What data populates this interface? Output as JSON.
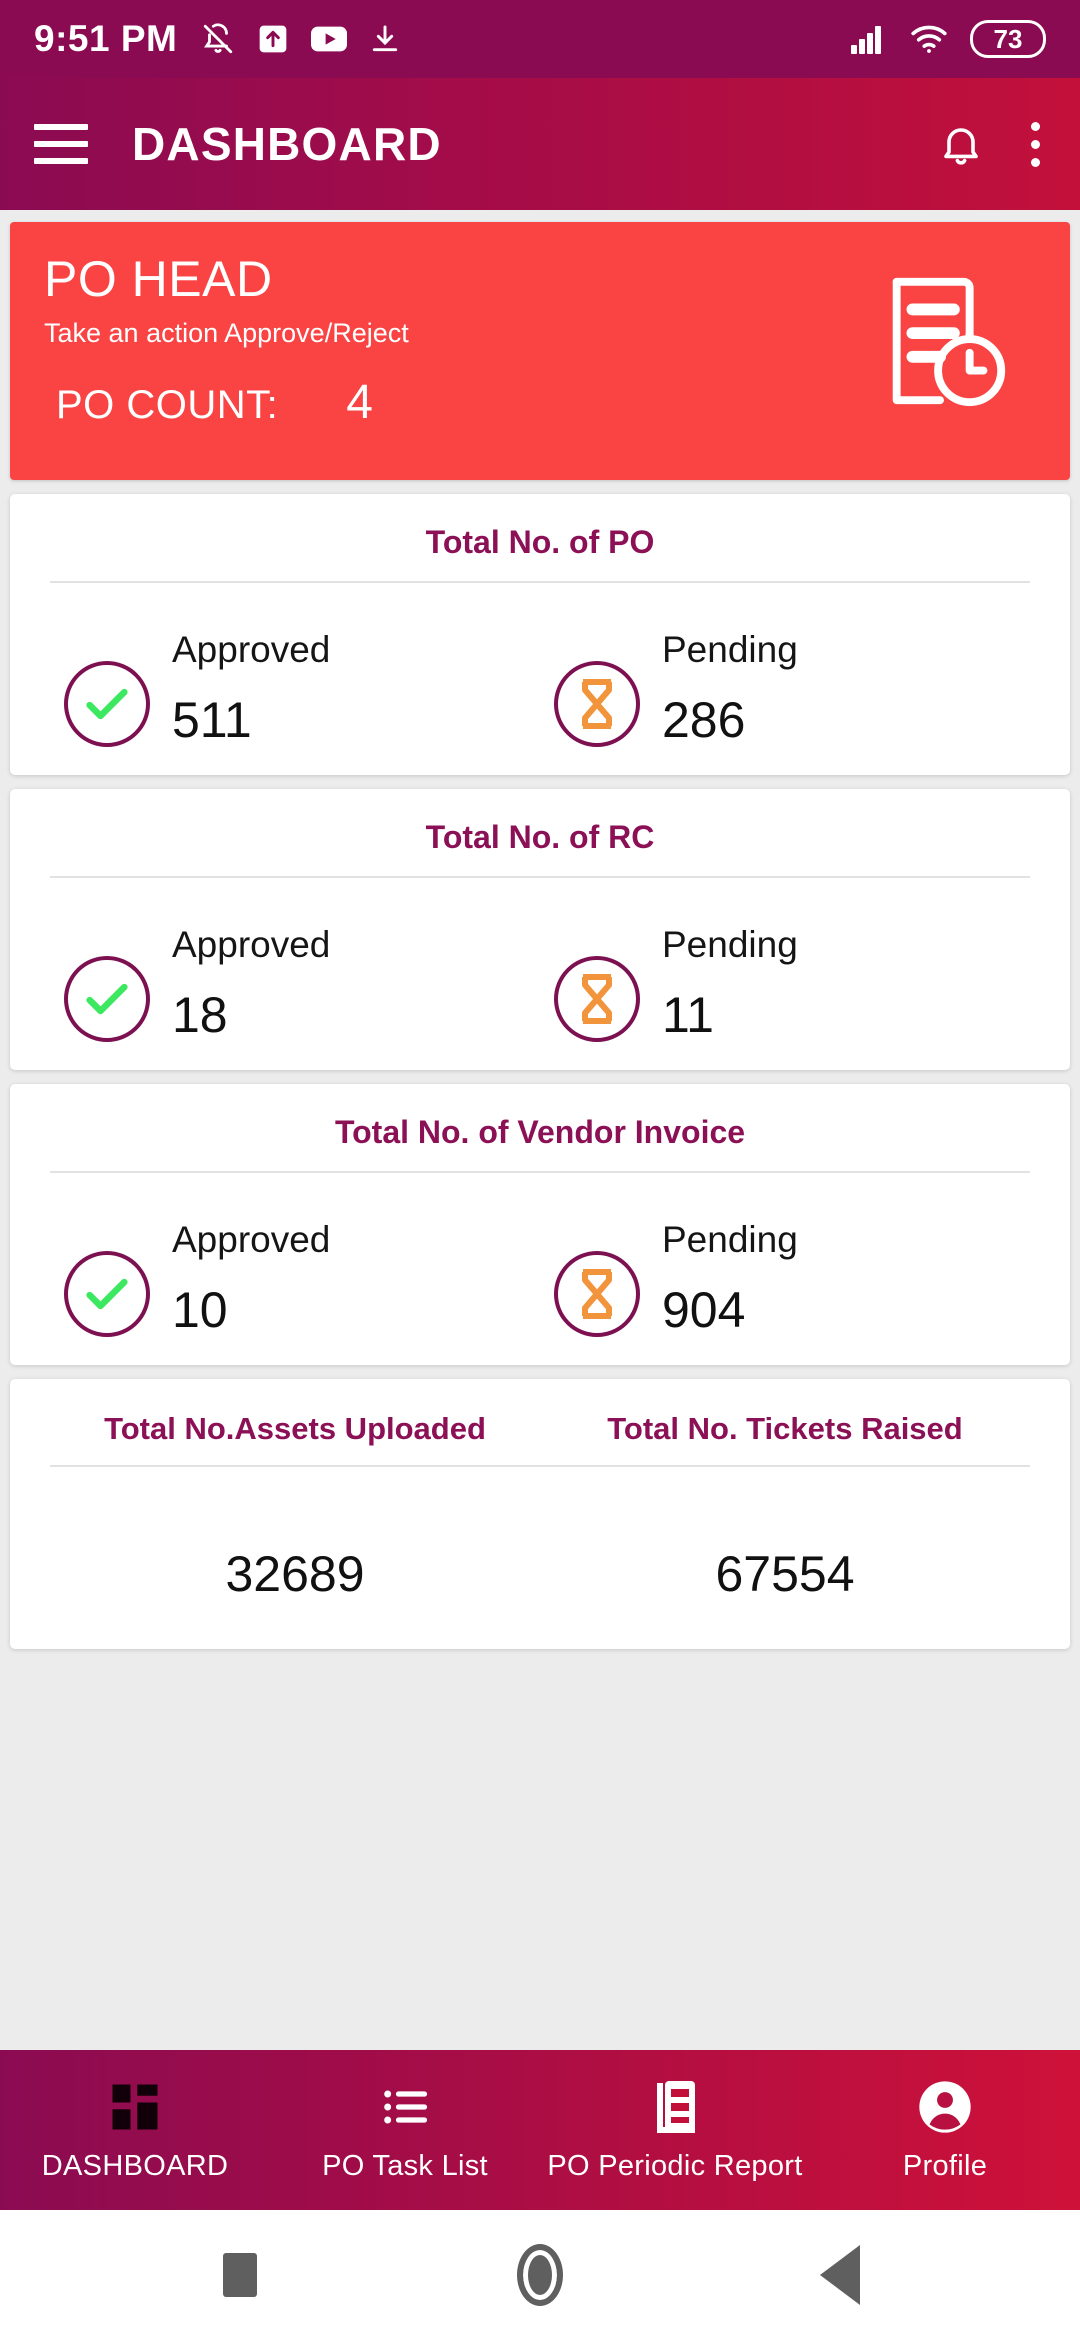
{
  "statusbar": {
    "time": "9:51 PM",
    "battery": "73",
    "icons": [
      "bell-off-icon",
      "upload-box-icon",
      "youtube-icon",
      "download-icon"
    ],
    "right_icons": [
      "signal-bars-icon",
      "wifi-icon",
      "battery-badge"
    ]
  },
  "appbar": {
    "title": "DASHBOARD",
    "menu_icon": "hamburger-menu-icon",
    "notification_icon": "bell-icon",
    "overflow_icon": "kebab-menu-icon",
    "gradient_start": "#8B0B52",
    "gradient_end": "#C2103A"
  },
  "po_head": {
    "title": "PO HEAD",
    "subtitle": "Take an action Approve/Reject",
    "count_label": "PO COUNT:",
    "count_value": "4",
    "bg_color": "#FA4444",
    "icon": "document-clock-icon"
  },
  "cards": [
    {
      "title": "Total No. of PO",
      "approved_label": "Approved",
      "approved_value": "511",
      "pending_label": "Pending",
      "pending_value": "286"
    },
    {
      "title": "Total No. of RC",
      "approved_label": "Approved",
      "approved_value": "18",
      "pending_label": "Pending",
      "pending_value": "11"
    },
    {
      "title": "Total No. of Vendor Invoice",
      "approved_label": "Approved",
      "approved_value": "10",
      "pending_label": "Pending",
      "pending_value": "904"
    }
  ],
  "dual_card": {
    "left_title": "Total No.Assets Uploaded",
    "left_value": "32689",
    "right_title": "Total No. Tickets Raised",
    "right_value": "67554"
  },
  "bottom_nav": {
    "items": [
      {
        "label": "DASHBOARD",
        "icon": "dashboard-grid-icon",
        "selected": true
      },
      {
        "label": "PO Task List",
        "icon": "list-icon",
        "selected": false
      },
      {
        "label": "PO Periodic Report",
        "icon": "report-document-icon",
        "selected": false
      },
      {
        "label": "Profile",
        "icon": "person-circle-icon",
        "selected": false
      }
    ]
  },
  "system_nav": {
    "recents": "square-recents-icon",
    "home": "circle-home-icon",
    "back": "triangle-back-icon"
  },
  "theme": {
    "accent_purple": "#8B1055",
    "check_green": "#3CE860",
    "hourglass_orange": "#F2943C",
    "card_bg": "#FFFFFF",
    "page_bg": "#ECECEC"
  }
}
